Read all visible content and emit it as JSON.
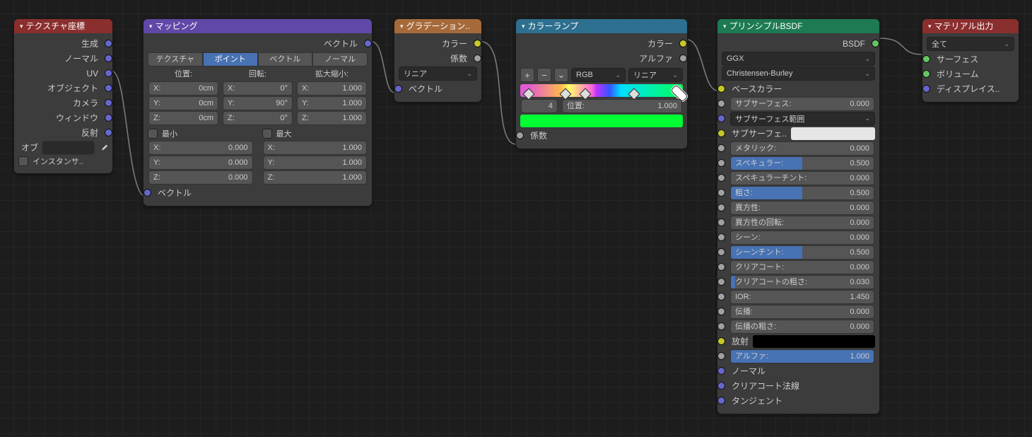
{
  "nodes": {
    "texcoord": {
      "title": "テクスチャ座標",
      "outputs": [
        "生成",
        "ノーマル",
        "UV",
        "オブジェクト",
        "カメラ",
        "ウィンドウ",
        "反射"
      ],
      "ob": "オブ",
      "instancer": "インスタンサ.."
    },
    "mapping": {
      "title": "マッピング",
      "output": "ベクトル",
      "tabs": [
        "テクスチャ",
        "ポイント",
        "ベクトル",
        "ノーマル"
      ],
      "tab_active": 1,
      "cols": [
        "位置:",
        "回転:",
        "拡大縮小:"
      ],
      "loc": {
        "x": "0cm",
        "y": "0cm",
        "z": "0cm"
      },
      "rot": {
        "x": "0°",
        "y": "90°",
        "z": "0°"
      },
      "scl": {
        "x": "1.000",
        "y": "1.000",
        "z": "1.000"
      },
      "axis": [
        "X:",
        "Y:",
        "Z:"
      ],
      "min": "最小",
      "max": "最大",
      "minv": {
        "x": "0.000",
        "y": "0.000",
        "z": "0.000"
      },
      "maxv": {
        "x": "1.000",
        "y": "1.000",
        "z": "1.000"
      },
      "input": "ベクトル"
    },
    "grad": {
      "title": "グラデーション..",
      "out_color": "カラー",
      "out_fac": "係数",
      "type": "リニア",
      "in_vec": "ベクトル"
    },
    "ramp": {
      "title": "カラーランプ",
      "out_color": "カラー",
      "out_alpha": "アルファ",
      "mode": "RGB",
      "interp": "リニア",
      "idx": "4",
      "pos_label": "位置:",
      "pos_val": "1.000",
      "swatch": "#00ff33",
      "in_fac": "係数",
      "plus": "+",
      "minus": "−",
      "chev": "⌄"
    },
    "bsdf": {
      "title": "プリンシプルBSDF",
      "out": "BSDF",
      "dist": "GGX",
      "sss": "Christensen-Burley",
      "rows": [
        {
          "k": "base",
          "label": "ベースカラー",
          "type": "color",
          "sock": "col"
        },
        {
          "k": "subsurf",
          "label": "サブサーフェス:",
          "val": "0.000",
          "fill": 0,
          "type": "slider",
          "sock": "fac"
        },
        {
          "k": "sssr",
          "label": "サブサーフェス範囲",
          "type": "select",
          "sock": "vec"
        },
        {
          "k": "sssc",
          "label": "サブサーフェ..",
          "type": "swatch",
          "color": "#e6e6e6",
          "sock": "col"
        },
        {
          "k": "met",
          "label": "メタリック:",
          "val": "0.000",
          "fill": 0,
          "type": "slider",
          "sock": "fac"
        },
        {
          "k": "spec",
          "label": "スペキュラー:",
          "val": "0.500",
          "fill": 50,
          "type": "slider",
          "sock": "fac"
        },
        {
          "k": "spect",
          "label": "スペキュラーチント:",
          "val": "0.000",
          "fill": 0,
          "type": "slider",
          "sock": "fac"
        },
        {
          "k": "rough",
          "label": "粗さ:",
          "val": "0.500",
          "fill": 50,
          "type": "slider",
          "sock": "fac"
        },
        {
          "k": "aniso",
          "label": "異方性:",
          "val": "0.000",
          "fill": 0,
          "type": "slider",
          "sock": "fac"
        },
        {
          "k": "anisor",
          "label": "異方性の回転:",
          "val": "0.000",
          "fill": 0,
          "type": "slider",
          "sock": "fac"
        },
        {
          "k": "sheen",
          "label": "シーン:",
          "val": "0.000",
          "fill": 0,
          "type": "slider",
          "sock": "fac"
        },
        {
          "k": "sheent",
          "label": "シーンチント:",
          "val": "0.500",
          "fill": 50,
          "type": "slider",
          "sock": "fac"
        },
        {
          "k": "cc",
          "label": "クリアコート:",
          "val": "0.000",
          "fill": 0,
          "type": "slider",
          "sock": "fac"
        },
        {
          "k": "ccr",
          "label": "クリアコートの粗さ:",
          "val": "0.030",
          "fill": 3,
          "type": "slider",
          "sock": "fac"
        },
        {
          "k": "ior",
          "label": "IOR:",
          "val": "1.450",
          "fill": 0,
          "type": "num",
          "sock": "fac"
        },
        {
          "k": "trans",
          "label": "伝播:",
          "val": "0.000",
          "fill": 0,
          "type": "slider",
          "sock": "fac"
        },
        {
          "k": "transr",
          "label": "伝播の粗さ:",
          "val": "0.000",
          "fill": 0,
          "type": "slider",
          "sock": "fac"
        },
        {
          "k": "emit",
          "label": "放射",
          "type": "swatch",
          "color": "#000000",
          "sock": "col"
        },
        {
          "k": "alpha",
          "label": "アルファ:",
          "val": "1.000",
          "fill": 100,
          "type": "slider",
          "sock": "fac"
        },
        {
          "k": "norm",
          "label": "ノーマル",
          "type": "label",
          "sock": "vec"
        },
        {
          "k": "ccn",
          "label": "クリアコート法線",
          "type": "label",
          "sock": "vec"
        },
        {
          "k": "tan",
          "label": "タンジェント",
          "type": "label",
          "sock": "vec"
        }
      ]
    },
    "out": {
      "title": "マテリアル出力",
      "target": "全て",
      "ins": [
        "サーフェス",
        "ボリューム",
        "ディスプレイス.."
      ]
    }
  }
}
